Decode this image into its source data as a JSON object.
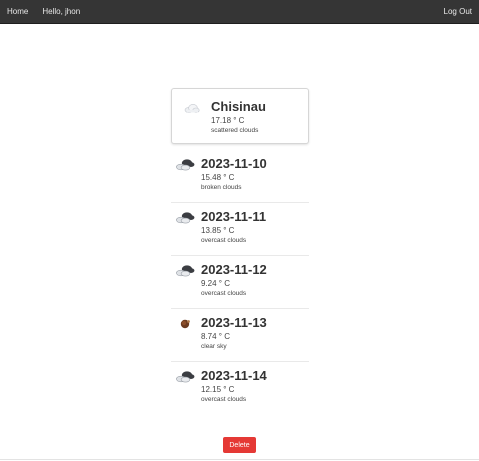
{
  "navbar": {
    "home_label": "Home",
    "greeting": "Hello, jhon",
    "logout_label": "Log Out"
  },
  "current": {
    "city": "Chisinau",
    "temp": "17.18 ° C",
    "description": "scattered clouds",
    "icon": "cloud-icon"
  },
  "forecast": [
    {
      "date": "2023-11-10",
      "temp": "15.48 ° C",
      "description": "broken clouds",
      "icon": "broken-clouds-icon"
    },
    {
      "date": "2023-11-11",
      "temp": "13.85 ° C",
      "description": "overcast clouds",
      "icon": "broken-clouds-icon"
    },
    {
      "date": "2023-11-12",
      "temp": "9.24 ° C",
      "description": "overcast clouds",
      "icon": "broken-clouds-icon"
    },
    {
      "date": "2023-11-13",
      "temp": "8.74 ° C",
      "description": "clear sky",
      "icon": "clear-sky-icon"
    },
    {
      "date": "2023-11-14",
      "temp": "12.15 ° C",
      "description": "overcast clouds",
      "icon": "broken-clouds-icon"
    }
  ],
  "actions": {
    "delete_label": "Delete",
    "delete_color": "#e53935"
  },
  "colors": {
    "navbar_bg": "#353535",
    "navbar_text": "#e8e8e8"
  }
}
